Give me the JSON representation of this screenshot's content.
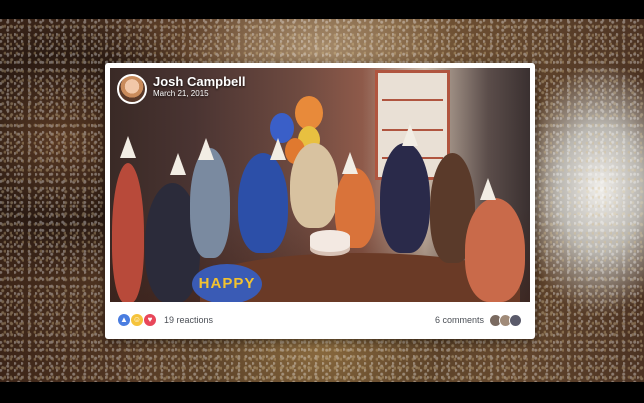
{
  "post": {
    "author": "Josh Campbell",
    "date": "March 21, 2015"
  },
  "photo": {
    "banner_text": "HAPPY"
  },
  "footer": {
    "reaction_icons": [
      "like-icon",
      "haha-icon",
      "love-icon"
    ],
    "reactions_label": "19 reactions",
    "comments_label": "6 comments"
  },
  "colors": {
    "like": "#4a7de0",
    "haha": "#f5c33b",
    "love": "#e8475a"
  }
}
